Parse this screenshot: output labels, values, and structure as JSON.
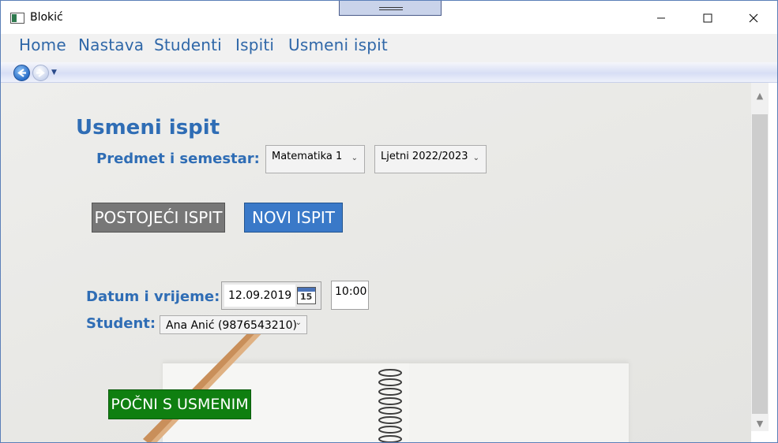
{
  "window": {
    "title": "Blokić"
  },
  "menu": {
    "items": [
      "Home",
      "Nastava",
      "Studenti",
      "Ispiti",
      "Usmeni ispit"
    ]
  },
  "page": {
    "title": "Usmeni ispit",
    "subject_label": "Predmet i semestar:",
    "subject_value": "Matematika 1",
    "semester_value": "Ljetni 2022/2023",
    "existing_button": "POSTOJEĆI ISPIT",
    "new_button": "NOVI ISPIT",
    "datetime_label": "Datum i vrijeme:",
    "date_value": "12.09.2019",
    "calendar_day": "15",
    "time_value": "10:00",
    "student_label": "Student:",
    "student_value": "Ana Anić (9876543210)",
    "start_button": "POČNI S USMENIM"
  },
  "colors": {
    "accent": "#2f6db5",
    "existing_button_bg": "#777777",
    "new_button_bg": "#3a79c8",
    "start_button_bg": "#0f7f10"
  },
  "icons": {
    "app": "app-icon",
    "back": "back-arrow-icon",
    "forward": "forward-arrow-icon",
    "calendar": "calendar-icon"
  }
}
